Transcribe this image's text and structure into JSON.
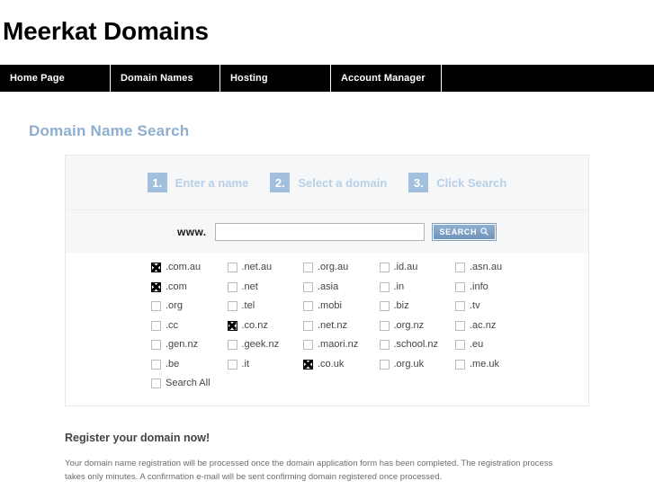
{
  "header": {
    "site_title": "Meerkat Domains"
  },
  "nav": {
    "items": [
      {
        "label": "Home Page"
      },
      {
        "label": "Domain Names"
      },
      {
        "label": "Hosting"
      },
      {
        "label": "Account Manager"
      }
    ]
  },
  "page": {
    "heading": "Domain Name Search"
  },
  "steps": [
    {
      "number": "1.",
      "label": "Enter a name"
    },
    {
      "number": "2.",
      "label": "Select a domain"
    },
    {
      "number": "3.",
      "label": "Click Search"
    }
  ],
  "search": {
    "prefix_label": "www.",
    "input_value": "",
    "input_placeholder": "",
    "button_label": "SEARCH",
    "button_icon": "magnifier-icon"
  },
  "tlds": {
    "rows": [
      [
        {
          "label": ".com.au",
          "checked": true
        },
        {
          "label": ".net.au",
          "checked": false
        },
        {
          "label": ".org.au",
          "checked": false
        },
        {
          "label": ".id.au",
          "checked": false
        },
        {
          "label": ".asn.au",
          "checked": false
        }
      ],
      [
        {
          "label": ".com",
          "checked": true
        },
        {
          "label": ".net",
          "checked": false
        },
        {
          "label": ".asia",
          "checked": false
        },
        {
          "label": ".in",
          "checked": false
        },
        {
          "label": ".info",
          "checked": false
        }
      ],
      [
        {
          "label": ".org",
          "checked": false
        },
        {
          "label": ".tel",
          "checked": false
        },
        {
          "label": ".mobi",
          "checked": false
        },
        {
          "label": ".biz",
          "checked": false
        },
        {
          "label": ".tv",
          "checked": false
        }
      ],
      [
        {
          "label": ".cc",
          "checked": false
        },
        {
          "label": ".co.nz",
          "checked": true
        },
        {
          "label": ".net.nz",
          "checked": false
        },
        {
          "label": ".org.nz",
          "checked": false
        },
        {
          "label": ".ac.nz",
          "checked": false
        }
      ],
      [
        {
          "label": ".gen.nz",
          "checked": false
        },
        {
          "label": ".geek.nz",
          "checked": false
        },
        {
          "label": ".maori.nz",
          "checked": false
        },
        {
          "label": ".school.nz",
          "checked": false
        },
        {
          "label": ".eu",
          "checked": false
        }
      ],
      [
        {
          "label": ".be",
          "checked": false
        },
        {
          "label": ".it",
          "checked": false
        },
        {
          "label": ".co.uk",
          "checked": true
        },
        {
          "label": ".org.uk",
          "checked": false
        },
        {
          "label": ".me.uk",
          "checked": false
        }
      ]
    ],
    "search_all": {
      "label": "Search All",
      "checked": false
    }
  },
  "footer": {
    "heading": "Register your domain now!",
    "body": "Your domain name registration will be processed once the domain application form has been completed. The registration process takes only minutes. A confirmation e-mail will be sent confirming domain registered once processed."
  },
  "colors": {
    "accent_blue": "#a2c0dd",
    "heading_blue": "#8eaed0",
    "nav_background": "#000000",
    "panel_background": "#f5f7f9"
  }
}
